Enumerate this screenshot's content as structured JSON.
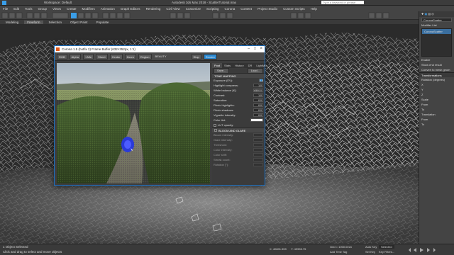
{
  "app": {
    "workspace": "Workspace: Default",
    "title": "Autodesk 3ds Max 2018",
    "file": "ScatterTutorial.max",
    "search_placeholder": "Type a keyword or phrase"
  },
  "menu": [
    "File",
    "Edit",
    "Tools",
    "Group",
    "Views",
    "Create",
    "Modifiers",
    "Animation",
    "Graph Editors",
    "Rendering",
    "Civil View",
    "Customize",
    "Scripting",
    "Corona",
    "Content",
    "Project Studio",
    "Custom Scripts",
    "Help"
  ],
  "ribbon": [
    "Modeling",
    "Freeform",
    "Selection",
    "Object Paint",
    "Populate"
  ],
  "framebuffer": {
    "title": "Corona 1.5 (hotfix 2) Frame Buffer (632×352px, 1:1)",
    "toolbar": [
      "RGB",
      "Alpha",
      "+Alfe",
      "Sheet",
      "Center",
      "Zoom",
      "Region",
      "BEAUTY",
      "Stop",
      "Render"
    ],
    "tabs": [
      "Post",
      "Stats",
      "History",
      "DR",
      "LightMix"
    ],
    "save": "Save...",
    "load": "Load...",
    "tone_mapping": "TONE MAPPING",
    "rows": [
      {
        "label": "Exposure (EV):",
        "value": "0.0"
      },
      {
        "label": "Highlight compress:",
        "value": "1.0"
      },
      {
        "label": "White balance [K]:",
        "value": "6500.0"
      },
      {
        "label": "Contrast:",
        "value": "1.0"
      },
      {
        "label": "Saturation:",
        "value": "0.0"
      },
      {
        "label": "Filmic highlights:",
        "value": "0.0"
      },
      {
        "label": "Filmic shadows:",
        "value": "0.0"
      },
      {
        "label": "Vignette intensity:",
        "value": "0.0"
      },
      {
        "label": "Color tint:",
        "value": ""
      }
    ],
    "lut_opacity": "LUT opacity:",
    "bloom_glare": "BLOOM AND GLARE",
    "bloom_rows": [
      "Bloom intensity:",
      "Glare intensity:",
      "Threshold:",
      "Color intensity:",
      "Color shift:",
      "Streak count:",
      "Rotation [°]:"
    ]
  },
  "cmdpanel": {
    "modifier_list": "Modifier List",
    "object_name": "CoronaScatter",
    "sections": [
      "Enable",
      "Show end result",
      "Convert to mesh geom"
    ],
    "transform": "Transformations",
    "rows": [
      "Rotation (degrees)",
      "X",
      "Y",
      "Z",
      "Scale",
      "From",
      "To",
      "Translation",
      "From",
      "To"
    ]
  },
  "status": {
    "selected": "1 Object Selected",
    "hint": "Click and drag to select and move objects",
    "x": "X: 40801.559",
    "y": "Y: 49955.75",
    "grid": "Grid = 1000.0mm",
    "add_time_tag": "Add Time Tag",
    "auto_key": "Auto Key",
    "set_key": "Set Key",
    "selected_label": "Selected",
    "key_filters": "Key Filters..."
  },
  "colors": {
    "accent": "#1d72c4",
    "active_blue": "#2a8ad4",
    "highlight": "#3a9ee8"
  }
}
